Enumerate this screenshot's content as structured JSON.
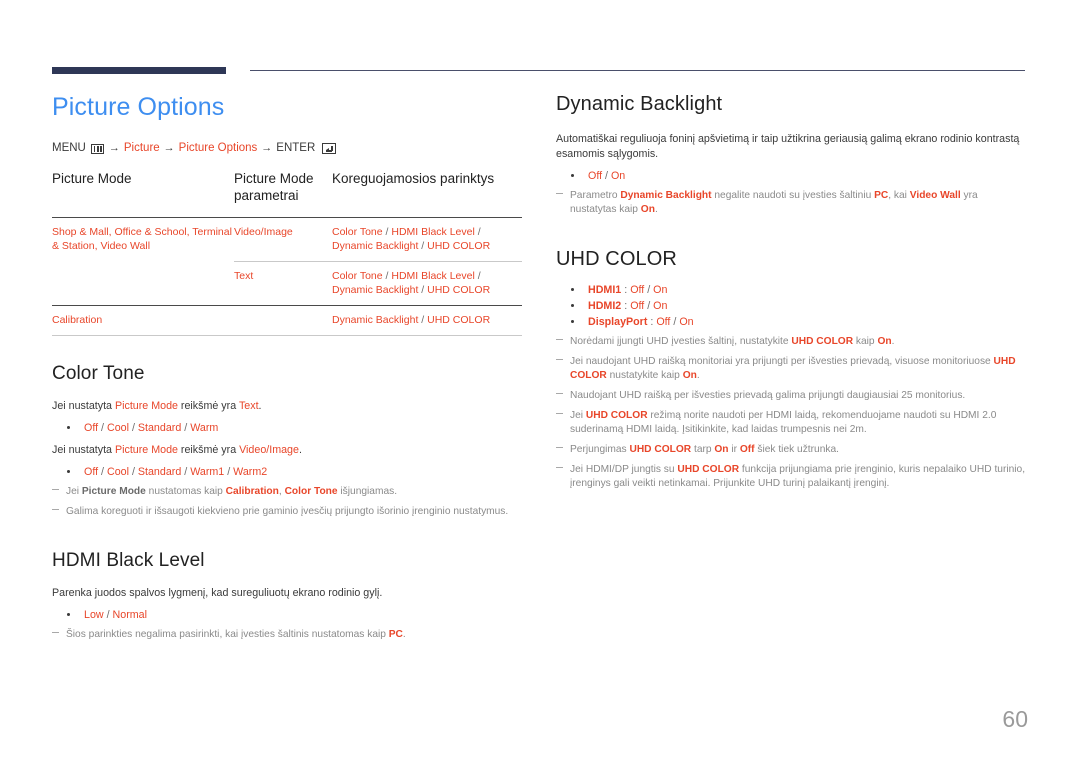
{
  "header": {
    "accent_color": "#2e3756",
    "rule_color": "#4a4f6b"
  },
  "page_number": "60",
  "colors": {
    "title_blue": "#3e8ef0",
    "highlight_red": "#e8462a",
    "note_gray": "#8a8a8a"
  },
  "left": {
    "title": "Picture Options",
    "menu_path": {
      "menu_label": "MENU",
      "menu_icon": "menu-grid-icon",
      "arrow1": "→",
      "item1": "Picture",
      "arrow2": "→",
      "item2": "Picture Options",
      "arrow3": "→",
      "enter_label": "ENTER",
      "enter_icon": "enter-key-icon"
    },
    "table": {
      "headers": [
        "Picture Mode",
        "Picture Mode parametrai",
        "Koreguojamosios parinktys"
      ],
      "rows": [
        {
          "mode": "Shop & Mall, Office & School, Terminal & Station, Video Wall",
          "param": "Video/Image",
          "options_line1_a": "Color Tone",
          "options_line1_sep": " / ",
          "options_line1_b": "HDMI Black Level",
          "options_line1_tail": " /",
          "options_line2_a": "Dynamic Backlight",
          "options_line2_sep": " / ",
          "options_line2_b": "UHD COLOR"
        },
        {
          "mode": "",
          "param": "Text",
          "options_line1_a": "Color Tone",
          "options_line1_sep": " / ",
          "options_line1_b": "HDMI Black Level",
          "options_line1_tail": " /",
          "options_line2_a": "Dynamic Backlight",
          "options_line2_sep": " / ",
          "options_line2_b": "UHD COLOR"
        },
        {
          "mode": "Calibration",
          "param": "",
          "options_line1_a": "Dynamic Backlight",
          "options_line1_sep": " / ",
          "options_line1_b": "UHD COLOR",
          "options_line1_tail": "",
          "options_line2_a": "",
          "options_line2_sep": "",
          "options_line2_b": ""
        }
      ]
    },
    "color_tone": {
      "heading": "Color Tone",
      "intro1_pre": "Jei nustatyta ",
      "intro1_em": "Picture Mode",
      "intro1_mid": " reikšmė yra ",
      "intro1_em2": "Text",
      "intro1_post": ".",
      "bullet1": {
        "o1": "Off",
        "o2": "Cool",
        "o3": "Standard",
        "o4": "Warm"
      },
      "intro2_pre": "Jei nustatyta ",
      "intro2_em": "Picture Mode",
      "intro2_mid": " reikšmė yra ",
      "intro2_em2": "Video/Image",
      "intro2_post": ".",
      "bullet2": {
        "o1": "Off",
        "o2": "Cool",
        "o3": "Standard",
        "o4": "Warm1",
        "o5": "Warm2"
      },
      "note1_pre": "Jei ",
      "note1_em1": "Picture Mode",
      "note1_mid": " nustatomas kaip ",
      "note1_em2": "Calibration",
      "note1_mid2": ", ",
      "note1_em3": "Color Tone",
      "note1_post": " išjungiamas.",
      "note2": "Galima koreguoti ir išsaugoti kiekvieno prie gaminio įvesčių prijungto išorinio įrenginio nustatymus."
    },
    "hdmi_black_level": {
      "heading": "HDMI Black Level",
      "intro": "Parenka juodos spalvos lygmenį, kad sureguliuotų ekrano rodinio gylį.",
      "bullet": {
        "o1": "Low",
        "o2": "Normal"
      },
      "note_pre": "Šios parinkties negalima pasirinkti, kai įvesties šaltinis nustatomas kaip ",
      "note_em": "PC",
      "note_post": "."
    }
  },
  "right": {
    "dynamic_backlight": {
      "heading": "Dynamic Backlight",
      "intro": "Automatiškai reguliuoja foninį apšvietimą ir taip užtikrina geriausią galimą ekrano rodinio kontrastą esamomis sąlygomis.",
      "bullet": {
        "o1": "Off",
        "o2": "On"
      },
      "note_pre": "Parametro ",
      "note_em1": "Dynamic Backlight",
      "note_mid": " negalite naudoti su įvesties šaltiniu ",
      "note_em2": "PC",
      "note_mid2": ", kai ",
      "note_em3": "Video Wall",
      "note_mid3": " yra nustatytas kaip ",
      "note_em4": "On",
      "note_post": "."
    },
    "uhd_color": {
      "heading": "UHD COLOR",
      "bullets": [
        {
          "port": "HDMI1",
          "sep": " : ",
          "o1": "Off",
          "o2": "On"
        },
        {
          "port": "HDMI2",
          "sep": " : ",
          "o1": "Off",
          "o2": "On"
        },
        {
          "port": "DisplayPort",
          "sep": " : ",
          "o1": "Off",
          "o2": "On"
        }
      ],
      "notes": [
        {
          "pre": "Norėdami įjungti UHD įvesties šaltinį, nustatykite ",
          "em1": "UHD COLOR",
          "mid": " kaip ",
          "em2": "On",
          "post": "."
        },
        {
          "pre": "Jei naudojant UHD raišką monitoriai yra prijungti per išvesties prievadą, visuose monitoriuose ",
          "em1": "UHD COLOR",
          "mid": " nustatykite kaip ",
          "em2": "On",
          "post": "."
        },
        {
          "pre": "Naudojant UHD raišką per išvesties prievadą galima prijungti daugiausiai 25 monitorius.",
          "em1": "",
          "mid": "",
          "em2": "",
          "post": ""
        },
        {
          "pre": "Jei ",
          "em1": "UHD COLOR",
          "mid": " režimą norite naudoti per HDMI laidą, rekomenduojame naudoti su HDMI 2.0 suderinamą HDMI laidą. Įsitikinkite, kad laidas trumpesnis nei 2m.",
          "em2": "",
          "post": ""
        },
        {
          "pre": "Perjungimas ",
          "em1": "UHD COLOR",
          "mid": " tarp ",
          "em2": "On",
          "mid2": " ir ",
          "em3": "Off",
          "post": " šiek tiek užtrunka."
        },
        {
          "pre": "Jei HDMI/DP jungtis su ",
          "em1": "UHD COLOR",
          "mid": " funkcija prijungiama prie įrenginio, kuris nepalaiko UHD turinio, įrenginys gali veikti netinkamai. Prijunkite UHD turinį palaikantį įrenginį.",
          "em2": "",
          "post": ""
        }
      ]
    }
  }
}
